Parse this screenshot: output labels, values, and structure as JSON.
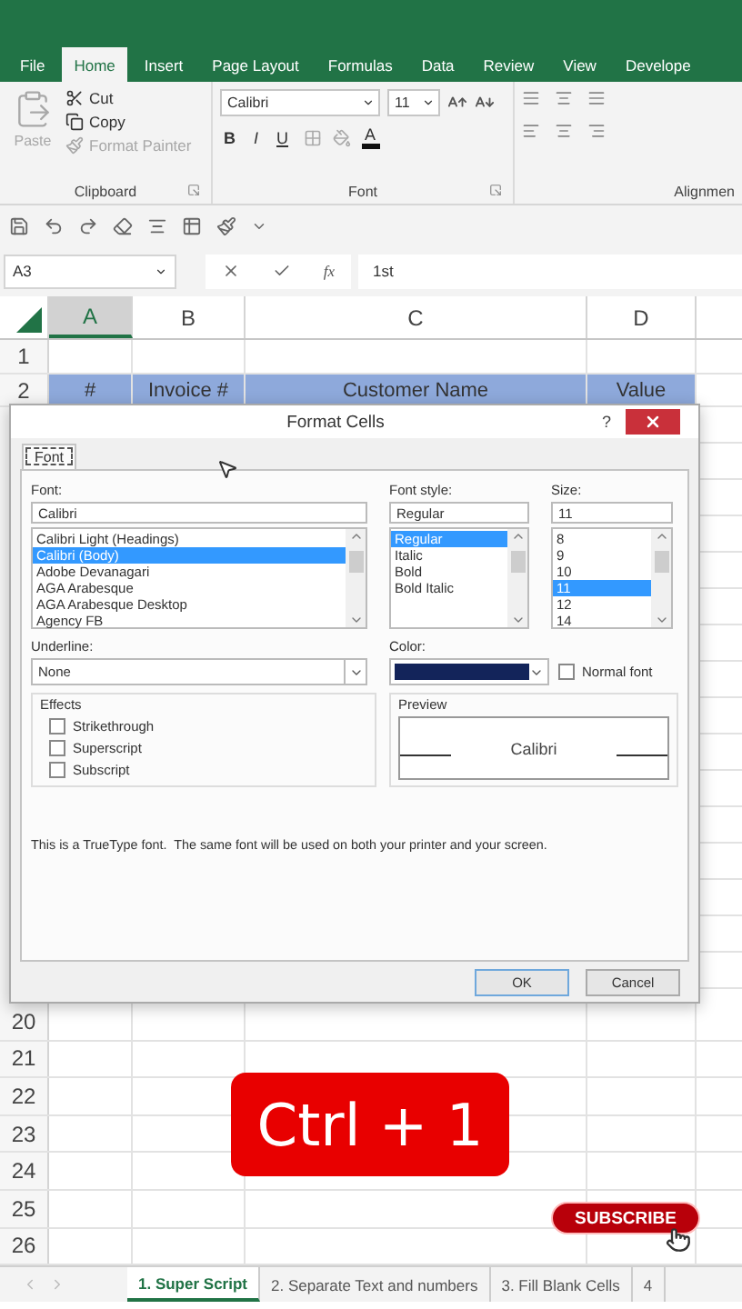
{
  "ribbon_tabs": [
    {
      "label": "File",
      "selected": false
    },
    {
      "label": "Home",
      "selected": true
    },
    {
      "label": "Insert",
      "selected": false
    },
    {
      "label": "Page Layout",
      "selected": false
    },
    {
      "label": "Formulas",
      "selected": false
    },
    {
      "label": "Data",
      "selected": false
    },
    {
      "label": "Review",
      "selected": false
    },
    {
      "label": "View",
      "selected": false
    },
    {
      "label": "Develope",
      "selected": false
    }
  ],
  "clipboard": {
    "paste": {
      "label": "Paste",
      "disabled": true
    },
    "items": [
      {
        "label": "Cut",
        "disabled": false
      },
      {
        "label": "Copy",
        "disabled": false
      },
      {
        "label": "Format Painter",
        "disabled": true
      }
    ],
    "label": "Clipboard"
  },
  "font_group": {
    "font": "Calibri",
    "size": "11",
    "bold": "B",
    "italic": "I",
    "underline": "U",
    "font_color": "A",
    "label": "Font"
  },
  "alignment_group": {
    "label": "Alignmen"
  },
  "formula_bar": {
    "name_box": "A3",
    "fx": "fx",
    "value": "1st"
  },
  "columns": [
    {
      "label": "A",
      "selected": true
    },
    {
      "label": "B",
      "selected": false
    },
    {
      "label": "C",
      "selected": false
    },
    {
      "label": "D",
      "selected": false
    }
  ],
  "rows": [
    {
      "number": "1",
      "kind": "plain",
      "cells": []
    },
    {
      "number": "2",
      "kind": "table_header",
      "cells": [
        "#",
        "Invoice #",
        "Customer Name",
        "Value"
      ]
    }
  ],
  "lower_rows": [
    "20",
    "21",
    "22",
    "23",
    "24",
    "25",
    "26"
  ],
  "dialog": {
    "title": "Format Cells",
    "help": "?",
    "tabs": [
      {
        "label": "Font",
        "selected": true
      }
    ],
    "font": {
      "label": "Font:",
      "value": "Calibri",
      "options": [
        {
          "label": "Calibri Light (Headings)",
          "selected": false
        },
        {
          "label": "Calibri (Body)",
          "selected": true
        },
        {
          "label": "Adobe Devanagari",
          "selected": false
        },
        {
          "label": "AGA Arabesque",
          "selected": false
        },
        {
          "label": "AGA Arabesque Desktop",
          "selected": false
        },
        {
          "label": "Agency FB",
          "selected": false
        }
      ]
    },
    "style": {
      "label": "Font style:",
      "value": "Regular",
      "options": [
        {
          "label": "Regular",
          "selected": true
        },
        {
          "label": "Italic",
          "selected": false
        },
        {
          "label": "Bold",
          "selected": false
        },
        {
          "label": "Bold Italic",
          "selected": false
        }
      ]
    },
    "size": {
      "label": "Size:",
      "value": "11",
      "options": [
        {
          "label": "8",
          "selected": false
        },
        {
          "label": "9",
          "selected": false
        },
        {
          "label": "10",
          "selected": false
        },
        {
          "label": "11",
          "selected": true
        },
        {
          "label": "12",
          "selected": false
        },
        {
          "label": "14",
          "selected": false
        }
      ]
    },
    "underline": {
      "label": "Underline:",
      "value": "None"
    },
    "color": {
      "label": "Color:"
    },
    "normal_font": {
      "label": "Normal font",
      "checked": false
    },
    "effects": {
      "label": "Effects",
      "items": [
        {
          "label": "Strikethrough",
          "checked": false
        },
        {
          "label": "Superscript",
          "checked": false
        },
        {
          "label": "Subscript",
          "checked": false
        }
      ]
    },
    "preview": {
      "label": "Preview",
      "text": "Calibri"
    },
    "note": "This is a TrueType font.  The same font will be used on both your printer and your screen.",
    "buttons": [
      {
        "label": "OK",
        "kind": "default"
      },
      {
        "label": "Cancel",
        "kind": "normal"
      }
    ]
  },
  "overlay": {
    "shortcut": "Ctrl + 1",
    "subscribe": "SUBSCRIBE"
  },
  "sheet_tabs": [
    {
      "label": "1. Super Script",
      "selected": true
    },
    {
      "label": "2. Separate Text and numbers",
      "selected": false
    },
    {
      "label": "3. Fill Blank Cells",
      "selected": false
    },
    {
      "label": "4",
      "selected": false
    }
  ]
}
